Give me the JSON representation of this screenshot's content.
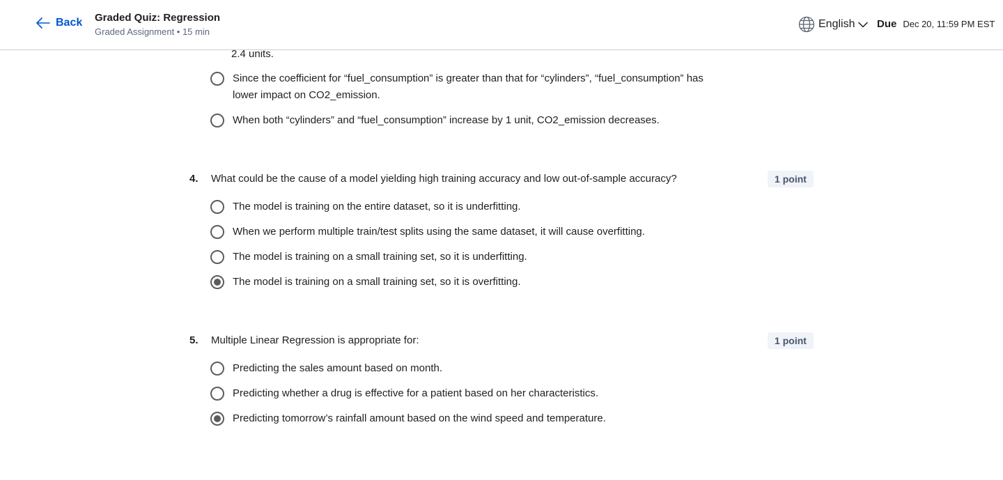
{
  "header": {
    "back_label": "Back",
    "title": "Graded Quiz: Regression",
    "subtitle": "Graded Assignment • 15 min",
    "language": "English",
    "due_label": "Due",
    "due_value": "Dec 20, 11:59 PM EST"
  },
  "q3": {
    "orphan_text": "2.4 units.",
    "options": [
      {
        "text": "Since the coefficient for “fuel_consumption” is greater than that for “cylinders”, “fuel_consumption” has lower impact on CO2_emission.",
        "selected": false
      },
      {
        "text": "When both “cylinders” and “fuel_consumption” increase by 1 unit, CO2_emission decreases.",
        "selected": false
      }
    ]
  },
  "q4": {
    "number": "4.",
    "question": "What could be the cause of a model yielding high training accuracy and low out-of-sample accuracy?",
    "points": "1 point",
    "options": [
      {
        "text": "The model is training on the entire dataset, so it is underfitting.",
        "selected": false
      },
      {
        "text": "When we perform multiple train/test splits using the same dataset, it will cause overfitting.",
        "selected": false
      },
      {
        "text": "The model is training on a small training set, so it is underfitting.",
        "selected": false
      },
      {
        "text": "The model is training on a small training set, so it is overfitting.",
        "selected": true
      }
    ]
  },
  "q5": {
    "number": "5.",
    "question": "Multiple Linear Regression is appropriate for:",
    "points": "1 point",
    "options": [
      {
        "text": "Predicting the sales amount based on month.",
        "selected": false
      },
      {
        "text": "Predicting whether a drug is effective for a patient based on her characteristics.",
        "selected": false
      },
      {
        "text": "Predicting tomorrow’s rainfall amount based on the wind speed and temperature.",
        "selected": true
      }
    ]
  },
  "colors": {
    "accent": "#0056d2",
    "radio": "#5c5c5c",
    "points_bg": "#f0f3f8"
  },
  "icons": {
    "back": "arrow-left-icon",
    "language": "globe-icon",
    "language_dropdown": "chevron-down-icon"
  }
}
